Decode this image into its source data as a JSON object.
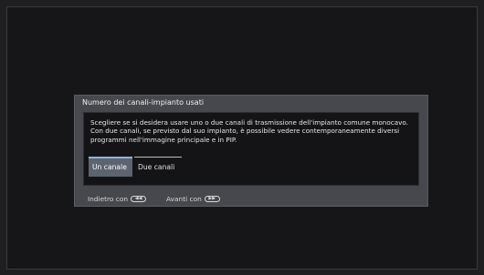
{
  "dialog": {
    "title": "Numero dei canali-impianto usati",
    "description": "Scegliere se si desidera usare uno o due canali di trasmissione dell'impianto comune monocavo. Con due canali, se previsto dal suo impianto, è possibile vedere contemporaneamente diversi programmi nell'immagine principale e in PIP.",
    "options": [
      {
        "label": "Un canale",
        "selected": true
      },
      {
        "label": "Due canali",
        "selected": false
      }
    ],
    "footer": {
      "back_label": "Indietro con",
      "back_icon": "rewind-button-icon",
      "back_glyph": "◀◀",
      "next_label": "Avanti con",
      "next_icon": "fast-forward-button-icon",
      "next_glyph": "▶▶"
    }
  },
  "colors": {
    "background": "#161618",
    "dialog": "#46484d",
    "selected_option": "#5c6470",
    "selection_accent": "#8fb3e0",
    "text": "#f0f0f0"
  }
}
